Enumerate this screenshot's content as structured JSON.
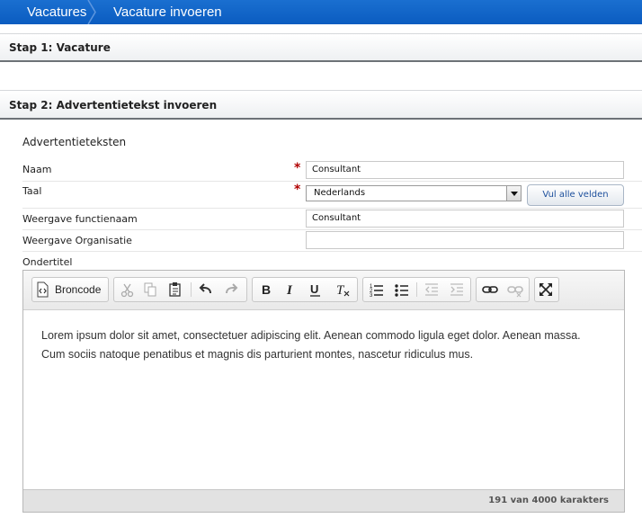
{
  "breadcrumb": {
    "items": [
      "Vacatures",
      "Vacature invoeren"
    ]
  },
  "steps": [
    {
      "title": "Stap 1: Vacature"
    },
    {
      "title": "Stap 2: Advertentietekst invoeren"
    }
  ],
  "section": {
    "title": "Advertentieteksten"
  },
  "form": {
    "naam": {
      "label": "Naam",
      "value": "Consultant",
      "required": true
    },
    "taal": {
      "label": "Taal",
      "value": "Nederlands",
      "required": true
    },
    "fill_button": "Vul alle velden",
    "functienaam": {
      "label": "Weergave functienaam",
      "value": "Consultant"
    },
    "organisatie": {
      "label": "Weergave Organisatie",
      "value": ""
    },
    "ondertitel": {
      "label": "Ondertitel"
    }
  },
  "editor": {
    "source_button": "Broncode",
    "content": "Lorem ipsum dolor sit amet, consectetuer adipiscing elit. Aenean commodo ligula eget dolor. Aenean massa. Cum sociis natoque penatibus et magnis dis parturient montes, nascetur ridiculus mus.",
    "char_count": "191 van 4000 karakters",
    "toolbar_icons": [
      "source-icon",
      "cut-icon",
      "copy-icon",
      "paste-icon",
      "undo-icon",
      "redo-icon",
      "bold-icon",
      "italic-icon",
      "underline-icon",
      "remove-format-icon",
      "numbered-list-icon",
      "bulleted-list-icon",
      "outdent-icon",
      "indent-icon",
      "link-icon",
      "unlink-icon",
      "maximize-icon"
    ]
  },
  "colors": {
    "breadcrumb_bg": "#0b5cc0",
    "required": "#b00000",
    "button_text": "#1c4f9c"
  }
}
